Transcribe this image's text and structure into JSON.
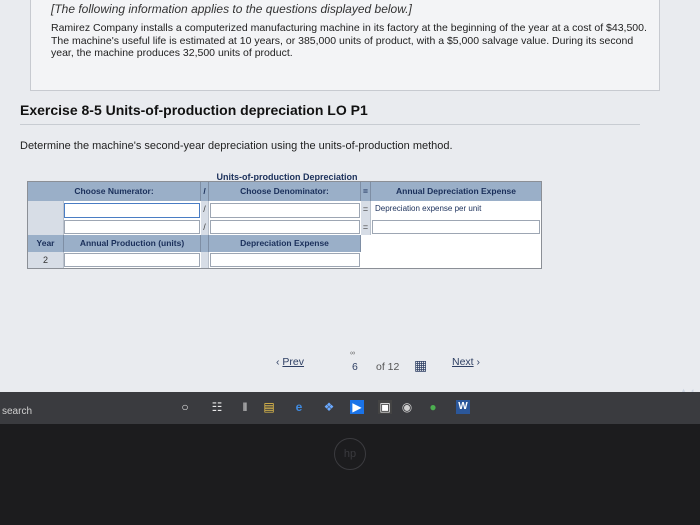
{
  "info": {
    "header": "[The following information applies to the questions displayed below.]",
    "body": "Ramirez Company installs a computerized manufacturing machine in its factory at the beginning of the year at a cost of $43,500. The machine's useful life is estimated at 10 years, or 385,000 units of product, with a $5,000 salvage value. During its second year, the machine produces 32,500 units of product."
  },
  "exercise": {
    "title": "Exercise 8-5 Units-of-production depreciation LO P1",
    "question": "Determine the machine's second-year depreciation using the units-of-production method."
  },
  "table": {
    "title": "Units-of-production Depreciation",
    "headers": {
      "numerator": "Choose Numerator:",
      "divide": "/",
      "denominator": "Choose Denominator:",
      "equals": "=",
      "result": "Annual Depreciation Expense"
    },
    "row1_result_label": "Depreciation expense per unit",
    "row2_divide": "/",
    "row2_equals": "=",
    "row3_divide": "/",
    "row3_equals": "=",
    "second": {
      "year_header": "Year",
      "production_header": "Annual Production (units)",
      "expense_header": "Depreciation Expense",
      "year_value": "2"
    }
  },
  "pager": {
    "prev": "Prev",
    "current": "6",
    "of": "of 12",
    "next": "Next"
  },
  "taskbar": {
    "search": "search"
  },
  "colors": {
    "header_blue": "#9aafc8",
    "header_text": "#1a2f5a",
    "link": "#2e3f63"
  }
}
